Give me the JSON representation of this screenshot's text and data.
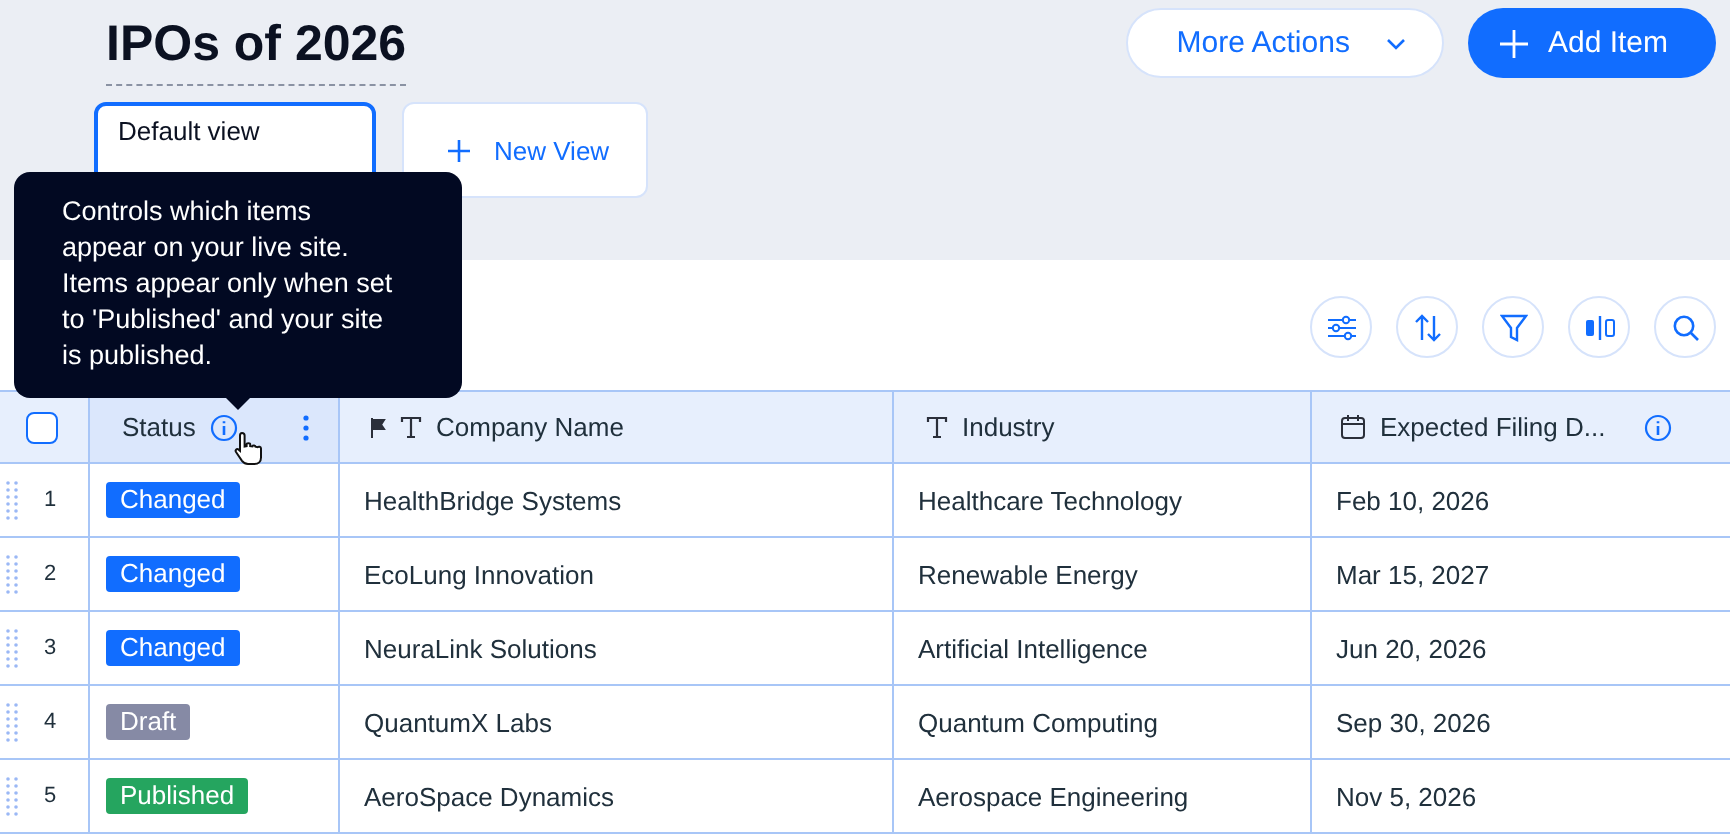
{
  "title": "IPOs of 2026",
  "actions": [
    {
      "label": "More Actions",
      "kind": "menu"
    },
    {
      "label": "Add Item",
      "kind": "primary"
    }
  ],
  "views": [
    {
      "label": "Default view",
      "selected": true,
      "kind": "view"
    },
    {
      "label": "New View",
      "selected": false,
      "kind": "add"
    }
  ],
  "tooltip": "Controls which items appear on your live site. Items appear only when set to 'Published' and your site is published.",
  "table": {
    "select_all": {
      "checked": false
    },
    "columns": [
      {
        "label": "Status",
        "kind": "status"
      },
      {
        "label": "Company Name",
        "kind": "primary-text"
      },
      {
        "label": "Industry",
        "kind": "text"
      },
      {
        "label": "Expected Filing D...",
        "kind": "date"
      }
    ],
    "rows": [
      {
        "number": "1",
        "status": "Changed",
        "color": "#116dff",
        "company": "HealthBridge Systems",
        "industry": "Healthcare Technology",
        "date": "Feb 10, 2026"
      },
      {
        "number": "2",
        "status": "Changed",
        "color": "#116dff",
        "company": "EcoLung Innovation",
        "industry": "Renewable Energy",
        "date": "Mar 15, 2027"
      },
      {
        "number": "3",
        "status": "Changed",
        "color": "#116dff",
        "company": "NeuraLink Solutions",
        "industry": "Artificial Intelligence",
        "date": "Jun 20, 2026"
      },
      {
        "number": "4",
        "status": "Draft",
        "color": "#868aa5",
        "company": "QuantumX Labs",
        "industry": "Quantum Computing",
        "date": "Sep 30, 2026"
      },
      {
        "number": "5",
        "status": "Published",
        "color": "#25a55f",
        "company": "AeroSpace Dynamics",
        "industry": "Aerospace Engineering",
        "date": "Nov 5, 2026"
      }
    ]
  }
}
